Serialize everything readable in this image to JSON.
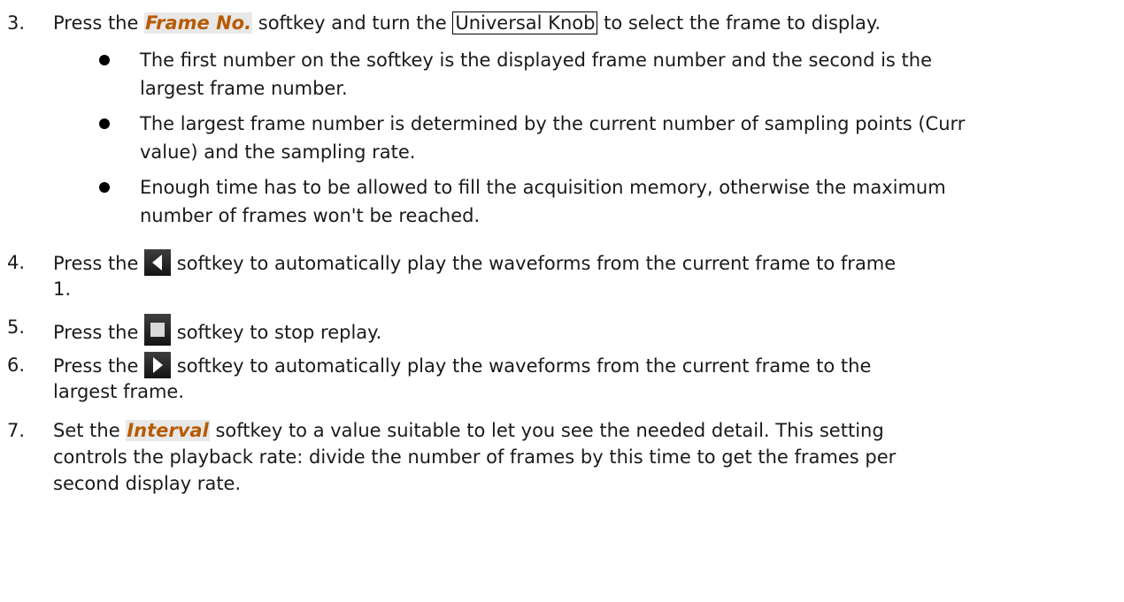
{
  "steps": [
    {
      "number": "3.",
      "pre": "Press the ",
      "key": "Frame No.",
      "mid": " softkey and turn the ",
      "boxed": "Universal Knob",
      "post": " to select the frame to display."
    },
    {
      "number": "4.",
      "pre": "Press the ",
      "icon": "play-backward-icon",
      "line1": " softkey to automatically play the waveforms from the current frame to frame",
      "line2": "1."
    },
    {
      "number": "5.",
      "pre": "Press the ",
      "icon": "stop-icon",
      "post": " softkey to stop replay."
    },
    {
      "number": "6.",
      "pre": "Press the ",
      "icon": "play-forward-icon",
      "line1": " softkey to automatically play the waveforms from the current frame to the",
      "line2": "largest frame."
    },
    {
      "number": "7.",
      "pre": "Set the ",
      "key": "Interval",
      "line1": " softkey to a value suitable to let you see the needed detail.  This setting",
      "line2": "controls the playback rate: divide the number of frames by this time to get the frames per",
      "line3": "second display rate."
    }
  ],
  "bullets": [
    {
      "line1": "The first number on the softkey is the displayed frame number and the second is the",
      "line2": "largest frame number."
    },
    {
      "line1": "The largest frame number is determined by the current number of sampling points (Curr",
      "line2": "value) and the sampling rate."
    },
    {
      "line1": "Enough time has to be allowed to fill the acquisition memory, otherwise the maximum",
      "line2": "number of frames won't be reached."
    }
  ],
  "colors": {
    "key_text": "#b85a00",
    "key_bg": "#e8e8e8",
    "icon_bg": "#1f1f1f",
    "icon_glyph": "#ffffff"
  }
}
